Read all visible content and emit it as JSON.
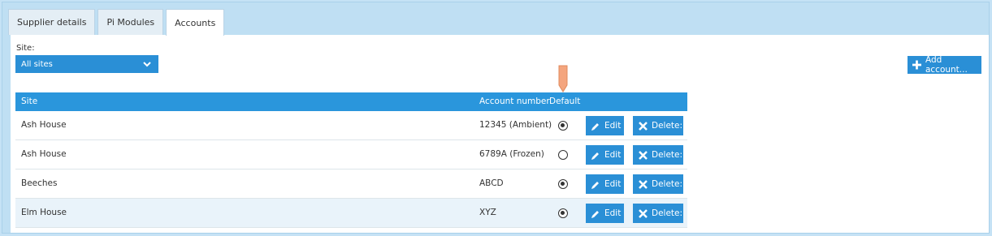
{
  "tabs": [
    {
      "label": "Supplier details",
      "active": false
    },
    {
      "label": "Pi Modules",
      "active": false
    },
    {
      "label": "Accounts",
      "active": true
    }
  ],
  "site_filter": {
    "label": "Site:",
    "selected": "All sites"
  },
  "add_button": {
    "label": "Add account..."
  },
  "grid": {
    "columns": {
      "site": "Site",
      "account_number": "Account number",
      "default": "Default"
    },
    "rows": [
      {
        "site": "Ash House",
        "account_number": "12345 (Ambient)",
        "default": true,
        "edit": "Edit",
        "delete": "Delete:"
      },
      {
        "site": "Ash House",
        "account_number": "6789A (Frozen)",
        "default": false,
        "edit": "Edit",
        "delete": "Delete:"
      },
      {
        "site": "Beeches",
        "account_number": "ABCD",
        "default": true,
        "edit": "Edit",
        "delete": "Delete:"
      },
      {
        "site": "Elm House",
        "account_number": "XYZ",
        "default": true,
        "edit": "Edit",
        "delete": "Delete:"
      }
    ]
  },
  "colors": {
    "accent": "#2a8fd6",
    "header": "#2a96dc",
    "frame": "#bfdff3",
    "marker": "#f4a57e"
  }
}
